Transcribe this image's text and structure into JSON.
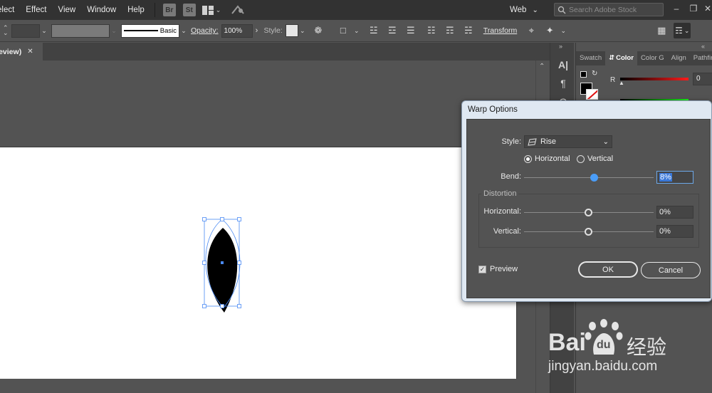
{
  "menubar": {
    "items": [
      "elect",
      "Effect",
      "View",
      "Window",
      "Help"
    ],
    "bridge_label": "Br",
    "stock_label": "St",
    "workspace": "Web",
    "search_placeholder": "Search Adobe Stock"
  },
  "controlbar": {
    "stroke_style": "Basic",
    "opacity_label": "Opacity:",
    "opacity_value": "100%",
    "style_label": "Style:",
    "transform_label": "Transform"
  },
  "tabbar": {
    "doc_tab_label": "review)"
  },
  "panel": {
    "tabs": [
      "Swatch",
      "Color",
      "Color G",
      "Align",
      "Pathfin"
    ],
    "active_tab": "Color",
    "channel_r": "R",
    "r_value": "0"
  },
  "dialog": {
    "title": "Warp Options",
    "style_label": "Style:",
    "style_value": "Rise",
    "orientation": {
      "horizontal": "Horizontal",
      "vertical": "Vertical",
      "selected": "horizontal"
    },
    "bend_label": "Bend:",
    "bend_value": "8%",
    "bend_fraction": 0.54,
    "distortion_title": "Distortion",
    "dist_horizontal_label": "Horizontal:",
    "dist_horizontal_value": "0%",
    "dist_vertical_label": "Vertical:",
    "dist_vertical_value": "0%",
    "preview_label": "Preview",
    "preview_checked": true,
    "ok_label": "OK",
    "cancel_label": "Cancel"
  },
  "watermark": {
    "brand": "Bai",
    "du": "du",
    "cn_text": "经验",
    "url": "jingyan.baidu.com"
  },
  "colors": {
    "menubar_bg": "#323232",
    "ui_bg": "#535353",
    "artboard": "#ffffff",
    "selection_blue": "#4a8af4",
    "slider_active": "#4a9df8",
    "dialog_frame": "#dfe8f2"
  }
}
